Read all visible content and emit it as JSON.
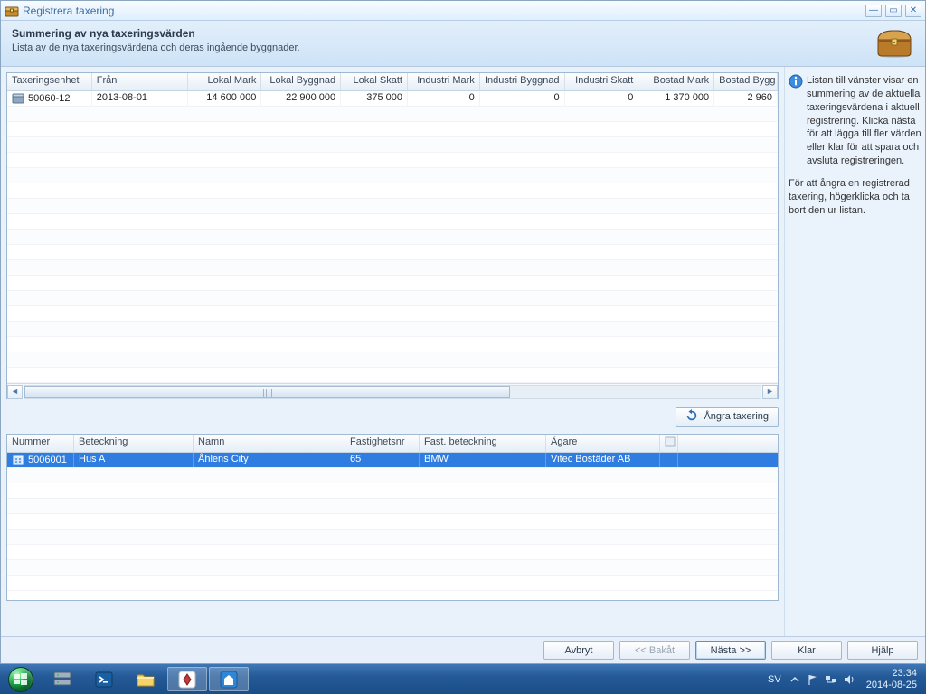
{
  "window": {
    "title": "Registrera taxering",
    "header_title": "Summering av nya taxeringsvärden",
    "header_sub": "Lista av de nya taxeringsvärdena och deras ingående byggnader."
  },
  "top_grid": {
    "columns": [
      "Taxeringsenhet",
      "Från",
      "Lokal Mark",
      "Lokal Byggnad",
      "Lokal Skatt",
      "Industri Mark",
      "Industri Byggnad",
      "Industri Skatt",
      "Bostad Mark",
      "Bostad Bygg"
    ],
    "row": {
      "taxeringsenhet": "50060-12",
      "fran": "2013-08-01",
      "lokal_mark": "14 600 000",
      "lokal_byggnad": "22 900 000",
      "lokal_skatt": "375 000",
      "industri_mark": "0",
      "industri_byggnad": "0",
      "industri_skatt": "0",
      "bostad_mark": "1 370 000",
      "bostad_bygg": "2 960"
    }
  },
  "undo_button": "Ångra taxering",
  "bottom_grid": {
    "columns": [
      "Nummer",
      "Beteckning",
      "Namn",
      "Fastighetsnr",
      "Fast. beteckning",
      "Ägare"
    ],
    "row": {
      "nummer": "5006001",
      "beteckning": "Hus A",
      "namn": "Åhlens City",
      "fastighetsnr": "65",
      "fast_beteckning": "BMW",
      "agare": "Vitec Bostäder AB"
    }
  },
  "info_panel": {
    "p1": "Listan till vänster visar en summering av de aktuella taxeringsvärdena i aktuell registrering. Klicka nästa för att lägga till fler värden eller klar för att spara och avsluta registreringen.",
    "p2": "För att ångra en registrerad taxering, högerklicka och ta bort den ur listan."
  },
  "footer": {
    "cancel": "Avbryt",
    "back": "<< Bakåt",
    "next": "Nästa >>",
    "done": "Klar",
    "help": "Hjälp"
  },
  "taskbar": {
    "lang": "SV",
    "time": "23:34",
    "date": "2014-08-25"
  }
}
